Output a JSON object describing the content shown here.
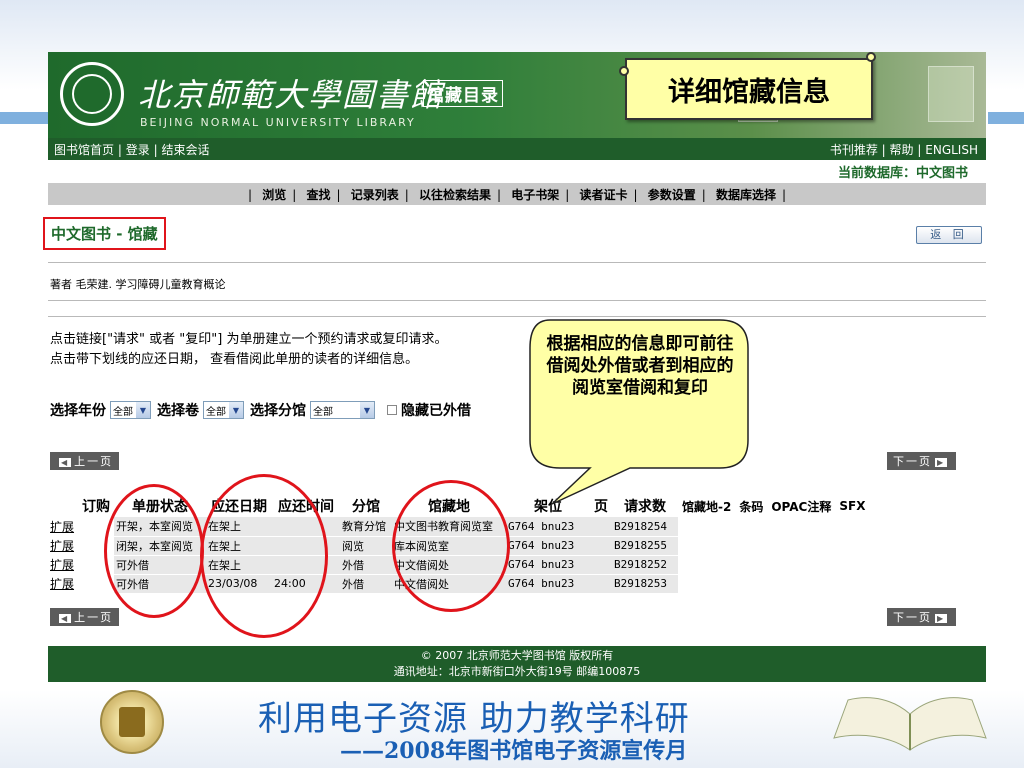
{
  "banner": {
    "library_name_cn": "北京師範大學圖書館",
    "library_name_en": "BEIJING NORMAL UNIVERSITY LIBRARY",
    "catalog_title": "馆藏目录",
    "callout": "详细馆藏信息"
  },
  "nav_top": {
    "left": [
      "图书馆首页",
      "登录",
      "结束会话"
    ],
    "right": [
      "书刊推荐",
      "帮助",
      "ENGLISH"
    ],
    "separator": "|"
  },
  "current_db": "当前数据库：中文图书",
  "nav_main": [
    "浏览",
    "查找",
    "记录列表",
    "以往检索结果",
    "电子书架",
    "读者证卡",
    "参数设置",
    "数据库选择"
  ],
  "section_title": "中文图书 - 馆藏",
  "back_button": "返 回",
  "author_line": "著者 毛荣建. 学习障碍儿童教育概论",
  "instructions": [
    "点击链接[\"请求\" 或者 \"复印\"] 为单册建立一个预约请求或复印请求。",
    "点击带下划线的应还日期， 查看借阅此单册的读者的详细信息。"
  ],
  "filters": {
    "year_label": "选择年份",
    "year_value": "全部",
    "volume_label": "选择卷",
    "volume_value": "全部",
    "branch_label": "选择分馆",
    "branch_value": "全部",
    "hide_label": "隐藏已外借"
  },
  "paging": {
    "prev": "上一页",
    "next": "下一页"
  },
  "table": {
    "headers": [
      "订购",
      "单册状态",
      "应还日期",
      "应还时间",
      "分馆",
      "馆藏地",
      "架位",
      "页",
      "请求数",
      "馆藏地-2",
      "条码",
      "OPAC注释",
      "SFX"
    ],
    "rows": [
      [
        "扩展",
        "开架，本室阅览",
        "在架上",
        "",
        "教育分馆",
        "中文图书教育阅览室",
        "G764 bnu23",
        "",
        "B2918254"
      ],
      [
        "扩展",
        "闭架，本室阅览",
        "在架上",
        "",
        "阅览",
        "库本阅览室",
        "G764 bnu23",
        "",
        "B2918255"
      ],
      [
        "扩展",
        "可外借",
        "在架上",
        "",
        "外借",
        "中文借阅处",
        "G764 bnu23",
        "",
        "B2918252"
      ],
      [
        "扩展",
        "可外借",
        "23/03/08",
        "24:00",
        "外借",
        "中文借阅处",
        "G764 bnu23",
        "",
        "B2918253"
      ]
    ]
  },
  "speech_callout": "根据相应的信息即可前往借阅处外借或者到相应的阅览室借阅和复印",
  "footer": {
    "line1": "© 2007 北京师范大学图书馆  版权所有",
    "line2": "通讯地址：北京市新街口外大街19号  邮编100875"
  },
  "slide": {
    "title": "利用电子资源 助力教学科研",
    "subtitle": "——2008年图书馆电子资源宣传月"
  },
  "colors": {
    "green": "#1f5d2a",
    "red_highlight": "#e0141b",
    "callout_yellow": "#ffffa6",
    "slide_blue": "#1a5fb4"
  }
}
